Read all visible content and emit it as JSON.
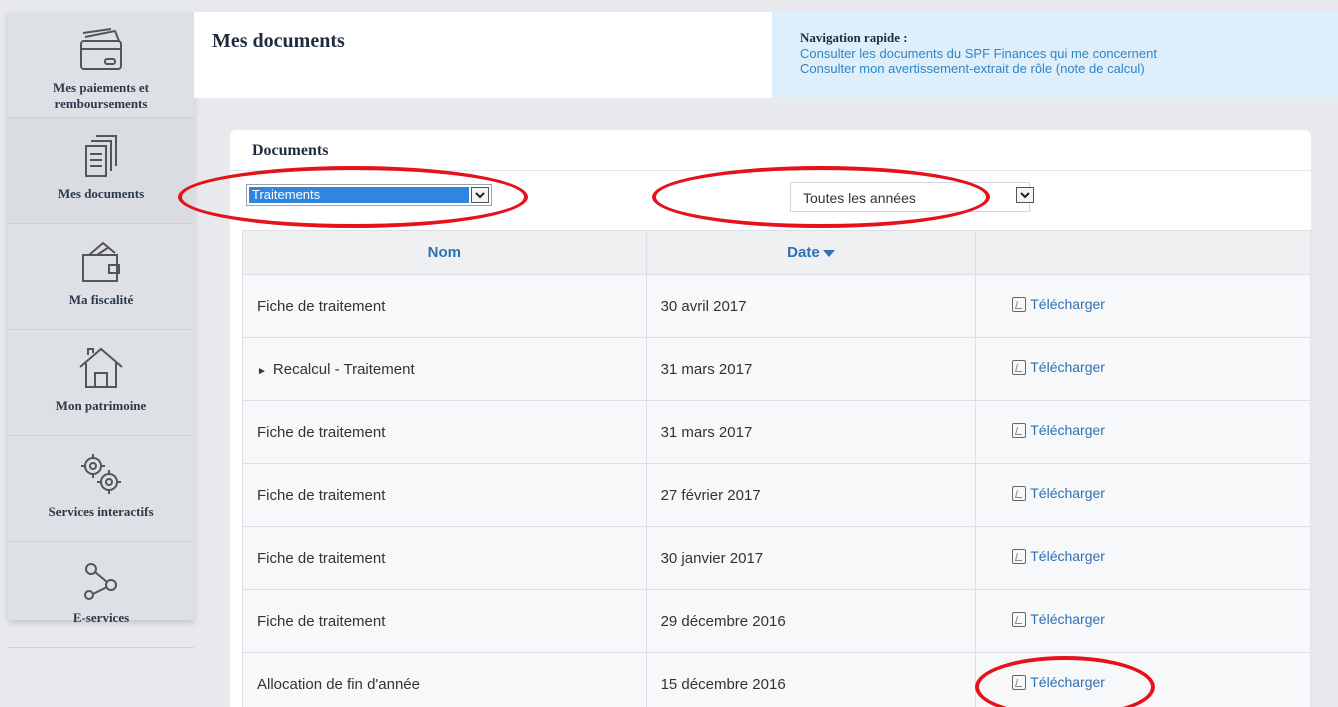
{
  "sidebar": {
    "items": [
      {
        "label": "Mes paiements et remboursements",
        "icon": "credit-card-icon"
      },
      {
        "label": "Mes documents",
        "icon": "documents-icon"
      },
      {
        "label": "Ma fiscalité",
        "icon": "wallet-icon"
      },
      {
        "label": "Mon patrimoine",
        "icon": "house-icon"
      },
      {
        "label": "Services interactifs",
        "icon": "gears-icon"
      },
      {
        "label": "E-services",
        "icon": "share-nodes-icon"
      }
    ]
  },
  "header": {
    "title": "Mes documents",
    "quicknav": {
      "title": "Navigation rapide :",
      "links": [
        "Consulter les documents du SPF Finances qui me concernent",
        "Consulter mon avertissement-extrait de rôle (note de calcul)"
      ]
    }
  },
  "documents": {
    "title": "Documents",
    "type_filter": "Traitements",
    "year_filter": "Toutes les années",
    "columns": {
      "name": "Nom",
      "date": "Date",
      "action": ""
    },
    "download_label": "Télécharger",
    "rows": [
      {
        "name": "Fiche de traitement",
        "date": "30 avril 2017",
        "expandable": false
      },
      {
        "name": "Recalcul - Traitement",
        "date": "31 mars 2017",
        "expandable": true
      },
      {
        "name": "Fiche de traitement",
        "date": "31 mars 2017",
        "expandable": false
      },
      {
        "name": "Fiche de traitement",
        "date": "27 février 2017",
        "expandable": false
      },
      {
        "name": "Fiche de traitement",
        "date": "30 janvier 2017",
        "expandable": false
      },
      {
        "name": "Fiche de traitement",
        "date": "29 décembre 2016",
        "expandable": false
      },
      {
        "name": "Allocation de fin d'année",
        "date": "15 décembre 2016",
        "expandable": false
      }
    ]
  },
  "colors": {
    "link": "#2f6fb3",
    "annotation": "#e6111a",
    "quicknav_bg": "#deeefa",
    "sidebar_bg": "#dde0e5"
  }
}
